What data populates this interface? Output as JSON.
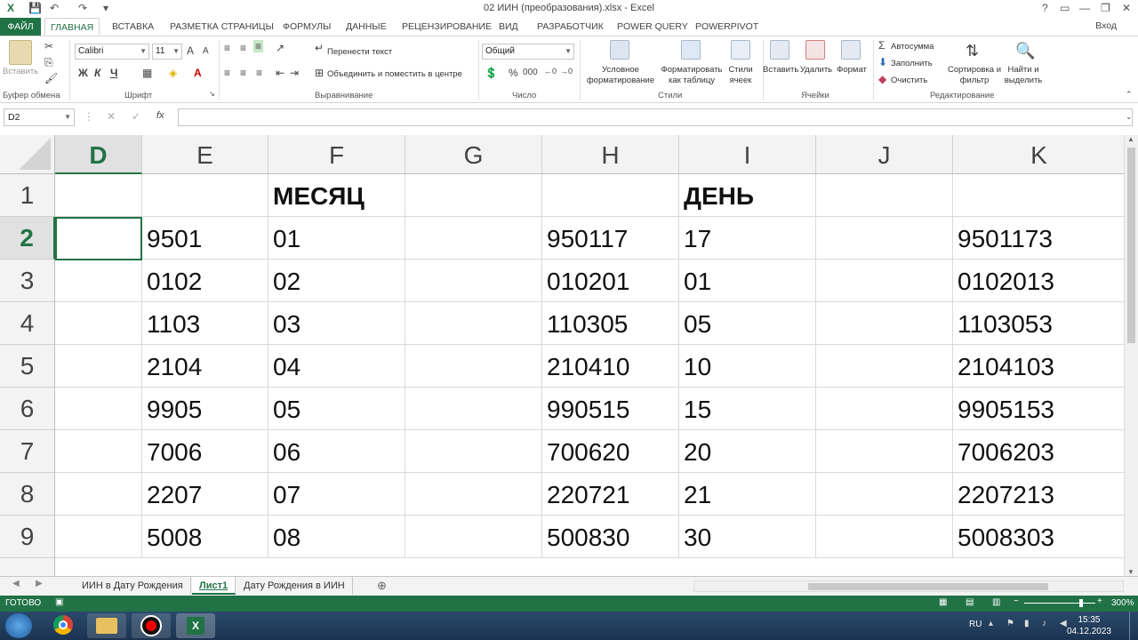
{
  "window": {
    "title": "02 ИИН (преобразования).xlsx - Excel",
    "controls": [
      "?",
      "▭",
      "—",
      "❐",
      "✕"
    ]
  },
  "ribbon_tabs": [
    {
      "label": "ФАЙЛ"
    },
    {
      "label": "ГЛАВНАЯ"
    },
    {
      "label": "ВСТАВКА"
    },
    {
      "label": "РАЗМЕТКА СТРАНИЦЫ"
    },
    {
      "label": "ФОРМУЛЫ"
    },
    {
      "label": "ДАННЫЕ"
    },
    {
      "label": "РЕЦЕНЗИРОВАНИЕ"
    },
    {
      "label": "ВИД"
    },
    {
      "label": "РАЗРАБОТЧИК"
    },
    {
      "label": "POWER QUERY"
    },
    {
      "label": "POWERPIVOT"
    }
  ],
  "signin": "Вход",
  "ribbon": {
    "clipboard": {
      "paste": "Вставить",
      "group": "Буфер обмена"
    },
    "font": {
      "name": "Calibri",
      "size": "11",
      "bold": "Ж",
      "italic": "К",
      "underline": "Ч",
      "group": "Шрифт"
    },
    "alignment": {
      "wrap": "Перенести текст",
      "merge": "Объединить и поместить в центре",
      "group": "Выравнивание"
    },
    "number": {
      "format": "Общий",
      "percent": "%",
      "thousands": "000",
      "group": "Число"
    },
    "styles": {
      "conditional": "Условное форматирование",
      "as_table": "Форматировать как таблицу",
      "cell_styles": "Стили ячеек",
      "group": "Стили"
    },
    "cells": {
      "insert": "Вставить",
      "delete": "Удалить",
      "format": "Формат",
      "group": "Ячейки"
    },
    "editing": {
      "autosum": "Автосумма",
      "fill": "Заполнить",
      "clear": "Очистить",
      "sort": "Сортировка и фильтр",
      "find": "Найти и выделить",
      "group": "Редактирование"
    }
  },
  "formula_bar": {
    "name_box": "D2",
    "fx": "fx",
    "formula": ""
  },
  "columns": [
    "D",
    "E",
    "F",
    "G",
    "H",
    "I",
    "J",
    "K"
  ],
  "selected_column": "D",
  "rows": [
    {
      "num": "1",
      "cells": [
        "",
        "",
        "МЕСЯЦ",
        "",
        "",
        "ДЕНЬ",
        "",
        ""
      ]
    },
    {
      "num": "2",
      "cells": [
        "",
        "9501",
        "01",
        "",
        "950117",
        "17",
        "",
        "9501173"
      ]
    },
    {
      "num": "3",
      "cells": [
        "",
        "0102",
        "02",
        "",
        "010201",
        "01",
        "",
        "0102013"
      ]
    },
    {
      "num": "4",
      "cells": [
        "",
        "1103",
        "03",
        "",
        "110305",
        "05",
        "",
        "1103053"
      ]
    },
    {
      "num": "5",
      "cells": [
        "",
        "2104",
        "04",
        "",
        "210410",
        "10",
        "",
        "2104103"
      ]
    },
    {
      "num": "6",
      "cells": [
        "",
        "9905",
        "05",
        "",
        "990515",
        "15",
        "",
        "9905153"
      ]
    },
    {
      "num": "7",
      "cells": [
        "",
        "7006",
        "06",
        "",
        "700620",
        "20",
        "",
        "7006203"
      ]
    },
    {
      "num": "8",
      "cells": [
        "",
        "2207",
        "07",
        "",
        "220721",
        "21",
        "",
        "2207213"
      ]
    },
    {
      "num": "9",
      "cells": [
        "",
        "5008",
        "08",
        "",
        "500830",
        "30",
        "",
        "5008303"
      ]
    }
  ],
  "selected_row": "2",
  "sheet_tabs": [
    {
      "label": "ИИН в Дату Рождения"
    },
    {
      "label": "Лист1",
      "active": true
    },
    {
      "label": "Дату Рождения в ИИН"
    }
  ],
  "status": {
    "ready": "ГОТОВО",
    "zoom": "300%"
  },
  "taskbar": {
    "lang": "RU",
    "time": "15:35",
    "date": "04.12.2023"
  }
}
